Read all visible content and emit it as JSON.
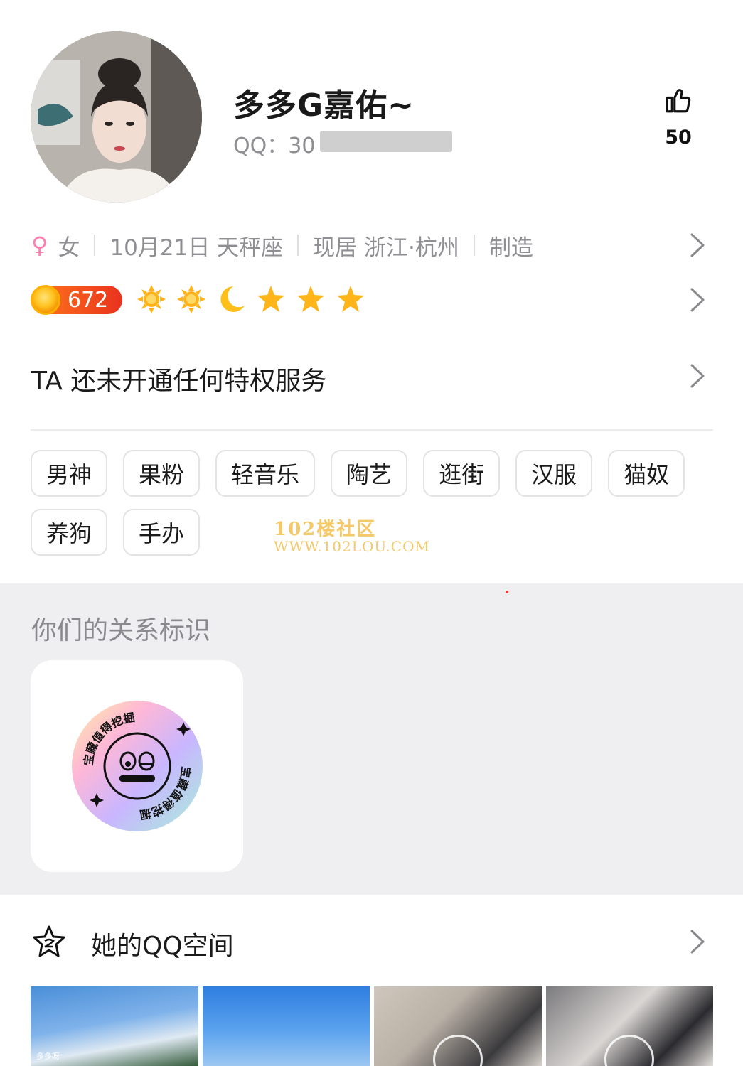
{
  "profile": {
    "nickname": "多多G嘉佑~",
    "qq_label": "QQ：30",
    "likes": "50"
  },
  "info": {
    "gender": "女",
    "birthday": "10月21日 天秤座",
    "location": "现居 浙江·杭州",
    "profession": "制造"
  },
  "level": {
    "value": "672",
    "icons": [
      "sun-icon",
      "sun-icon",
      "moon-icon",
      "star-icon",
      "star-icon",
      "star-icon"
    ]
  },
  "privilege_text": "TA 还未开通任何特权服务",
  "tags": [
    "男神",
    "果粉",
    "轻音乐",
    "陶艺",
    "逛街",
    "汉服",
    "猫奴",
    "养狗",
    "手办"
  ],
  "watermark": {
    "line1": "102楼社区",
    "line2": "WWW.102LOU.COM"
  },
  "relationship": {
    "title": "你们的关系标识",
    "badge_text": "宝藏值得挖掘"
  },
  "qzone": {
    "title": "她的QQ空间",
    "photo_caption": "多多呀"
  },
  "colors": {
    "accent_orange": "#ff7a1a",
    "gender_pink": "#ff7fb0",
    "section_bg": "#efeff1"
  }
}
